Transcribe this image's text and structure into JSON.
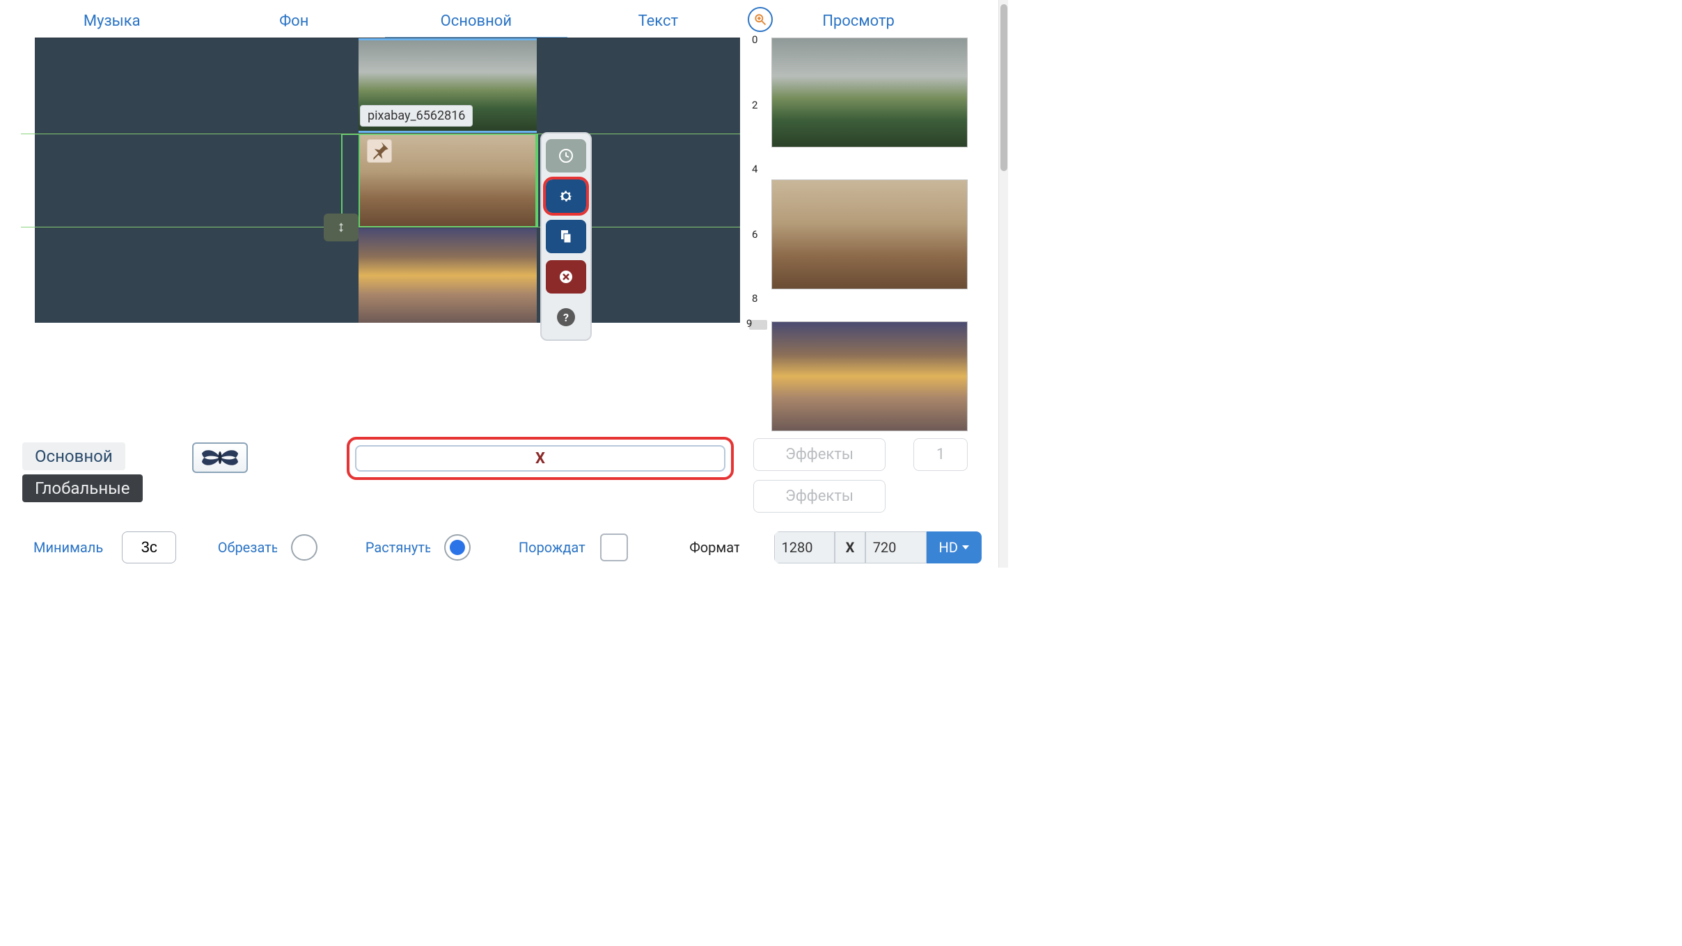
{
  "tabs": {
    "music": "Музыка",
    "background": "Фон",
    "main": "Основной",
    "text": "Текст",
    "preview": "Просмотр"
  },
  "clip": {
    "label": "pixabay_6562816"
  },
  "ruler": {
    "ticks": [
      "0",
      "2",
      "4",
      "6",
      "8"
    ],
    "marker": "9"
  },
  "tools": {
    "time": "time-icon",
    "settings": "gear-icon",
    "copy": "copy-icon",
    "delete": "delete-icon",
    "help": "?"
  },
  "settings": {
    "tab_main": "Основной",
    "tab_global": "Глобальные",
    "x_label": "X",
    "effects_label": "Эффекты",
    "effects_count": "1"
  },
  "bottom": {
    "min_label": "Минималь",
    "min_value": "3с",
    "crop_label": "Обрезать",
    "stretch_label": "Растянуть",
    "spawn_label": "Порождать",
    "format_label": "Формат",
    "format_w": "1280",
    "format_x": "X",
    "format_h": "720",
    "hd_label": "HD"
  }
}
